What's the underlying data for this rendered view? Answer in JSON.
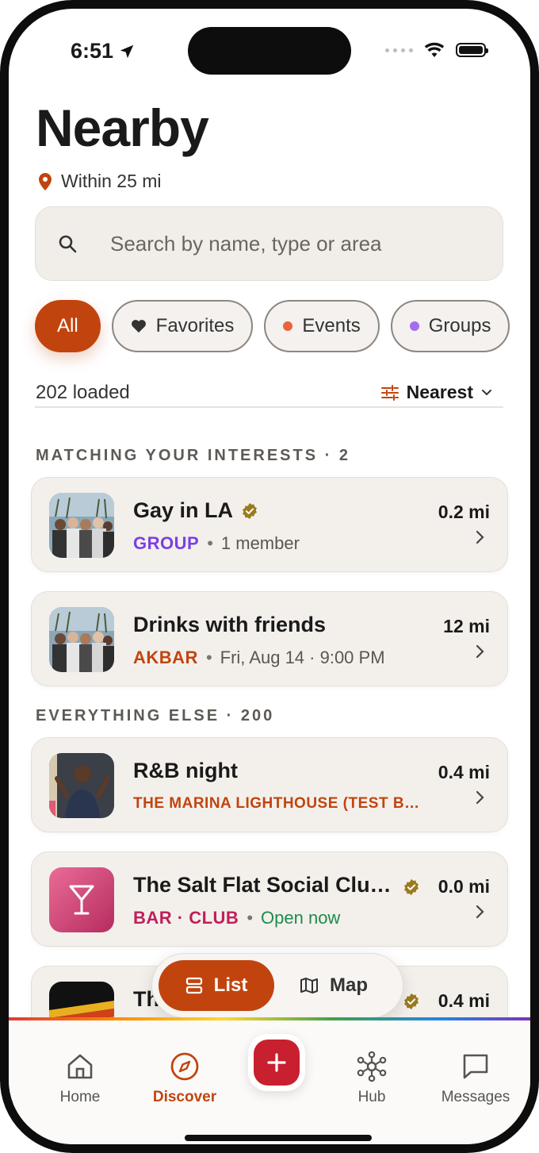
{
  "status_bar": {
    "time": "6:51"
  },
  "header": {
    "title": "Nearby",
    "radius_label": "Within 25 mi"
  },
  "search": {
    "placeholder": "Search by name, type or area"
  },
  "filters": [
    {
      "label": "All",
      "active": true
    },
    {
      "label": "Favorites",
      "icon": "heart-icon"
    },
    {
      "label": "Events",
      "dot_color": "#e8643a"
    },
    {
      "label": "Groups",
      "dot_color": "#a66cf0"
    }
  ],
  "results": {
    "count_label": "202 loaded",
    "sort_label": "Nearest"
  },
  "sections": {
    "matching": "MATCHING YOUR INTERESTS · 2",
    "else": "EVERYTHING ELSE · 200"
  },
  "items": [
    {
      "title": "Gay in LA",
      "verified": true,
      "tag": "GROUP",
      "tag_color": "#7b3fe4",
      "meta": "1 member",
      "distance": "0.2 mi",
      "thumb": "crowd-photo"
    },
    {
      "title": "Drinks with friends",
      "verified": false,
      "tag": "AKBAR",
      "tag_color": "#c1440e",
      "meta": "Fri, Aug 14 · 9:00 PM",
      "distance": "12 mi",
      "thumb": "crowd-photo"
    },
    {
      "title": "R&B night",
      "verified": false,
      "tag": "THE MARINA LIGHTHOUSE (TEST B…",
      "tag_color": "#c1440e",
      "meta": "",
      "distance": "0.4 mi",
      "thumb": "performer-photo"
    },
    {
      "title": "The Salt Flat Social Clu…",
      "verified": true,
      "tag": "BAR · CLUB",
      "tag_color": "#c01f5c",
      "meta": "Open now",
      "meta_color": "#1f8a4c",
      "distance": "0.0 mi",
      "thumb": "cocktail-icon"
    },
    {
      "title": "Th",
      "verified": true,
      "tag": "",
      "meta": "",
      "distance": "0.4 mi",
      "thumb": "stripes-photo"
    }
  ],
  "view_toggle": {
    "list": "List",
    "map": "Map",
    "active": "list"
  },
  "tabbar": [
    {
      "label": "Home",
      "icon": "home-icon"
    },
    {
      "label": "Discover",
      "icon": "compass-icon",
      "active": true
    },
    {
      "label": "",
      "icon": "plus-icon"
    },
    {
      "label": "Hub",
      "icon": "network-icon"
    },
    {
      "label": "Messages",
      "icon": "message-icon"
    }
  ],
  "colors": {
    "accent": "#c1440e",
    "card_bg": "#f3f0ec",
    "verified": "#9a7a1c",
    "plus_button": "#c8202f"
  }
}
